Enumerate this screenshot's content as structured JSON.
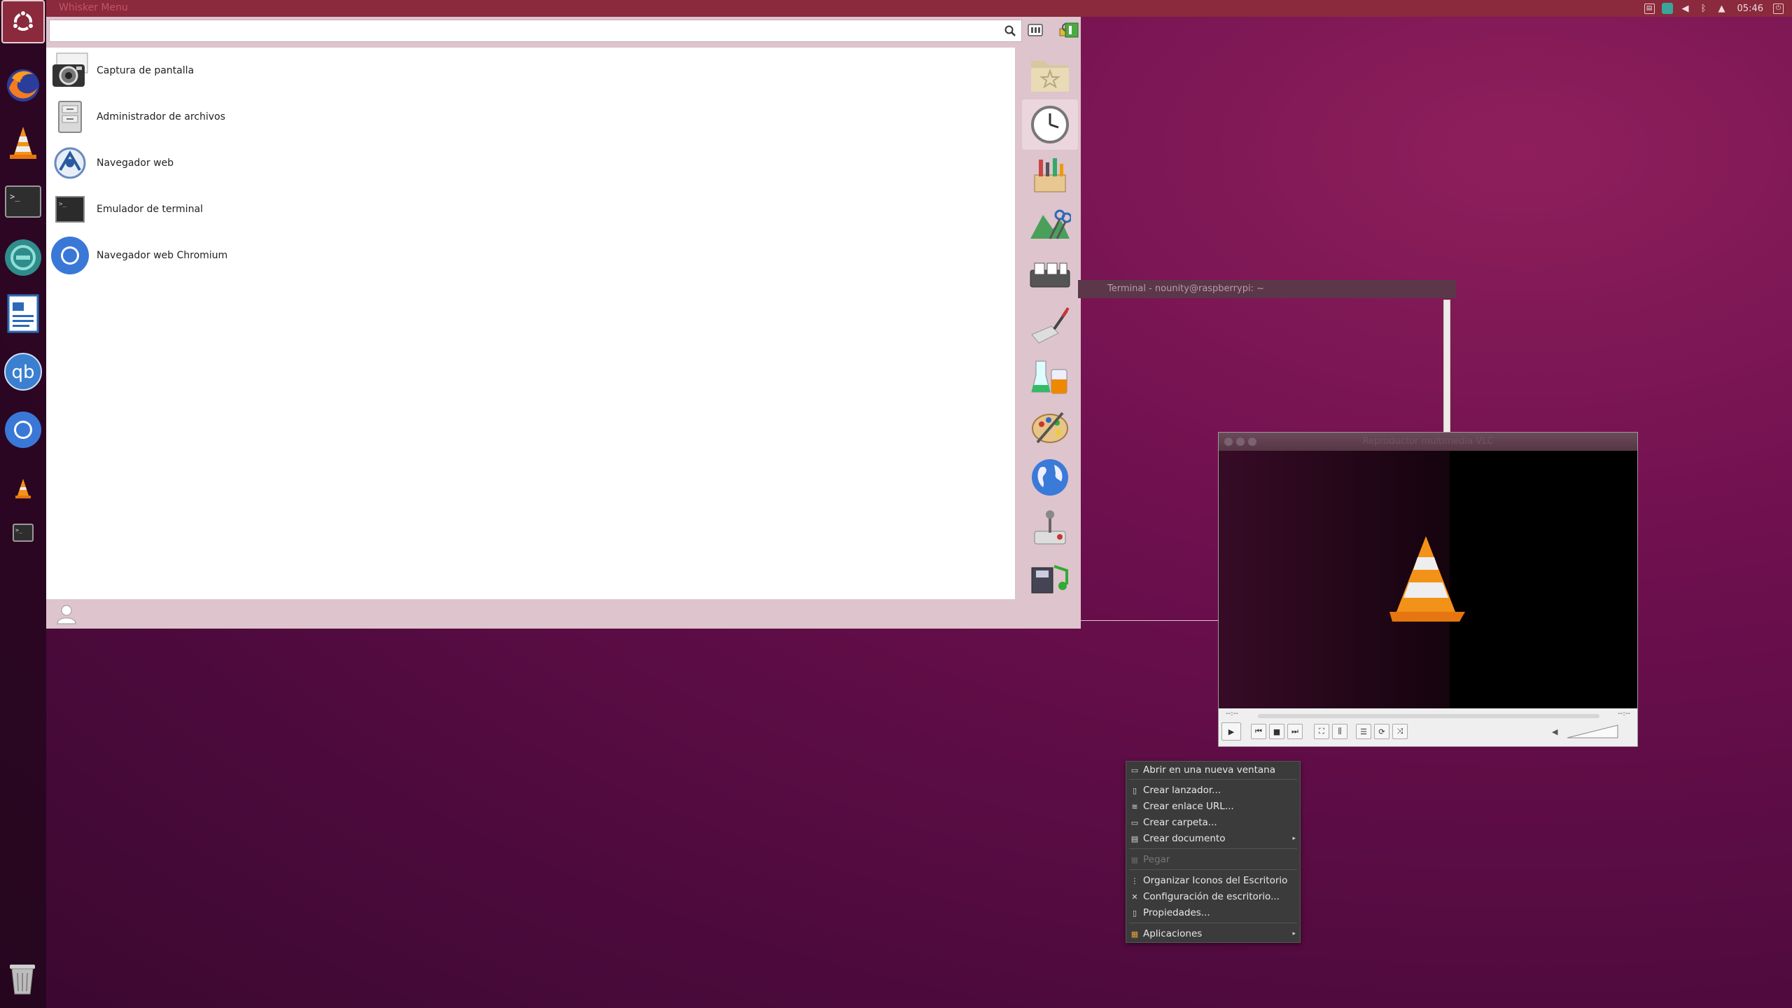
{
  "top_panel": {
    "title": "Whisker Menu",
    "clock": "05:46",
    "tray_icons": [
      "screen-icon",
      "network-icon",
      "volume-icon",
      "bluetooth-icon",
      "notification-bell-icon",
      "session-icon"
    ]
  },
  "launcher": {
    "items": [
      "Firefox",
      "VLC",
      "Terminal",
      "Network",
      "Writer",
      "qBittorrent",
      "Chromium",
      "VLC small",
      "Terminal small"
    ],
    "qb_label": "qb"
  },
  "whisker": {
    "search_placeholder": "",
    "apps": [
      {
        "label": "Captura de pantalla",
        "icon": "camera-icon"
      },
      {
        "label": "Administrador de archivos",
        "icon": "file-cabinet-icon"
      },
      {
        "label": "Navegador web",
        "icon": "web-browser-icon"
      },
      {
        "label": "Emulador de terminal",
        "icon": "terminal-icon"
      },
      {
        "label": "Navegador web Chromium",
        "icon": "chromium-icon"
      }
    ],
    "categories": [
      "favorites",
      "recently-used",
      "accessories",
      "office-tools",
      "system",
      "development",
      "science",
      "graphics",
      "internet",
      "games",
      "multimedia"
    ]
  },
  "terminal": {
    "title": "Terminal - nounity@raspberrypi: ~"
  },
  "vlc": {
    "title": "Reproductor multimedia VLC",
    "time_left": "--:--",
    "time_right": "--:--"
  },
  "context_menu": {
    "items": [
      {
        "label": "Abrir en una nueva ventana",
        "enabled": true
      },
      {
        "label": "Crear lanzador...",
        "enabled": true
      },
      {
        "label": "Crear enlace URL...",
        "enabled": true
      },
      {
        "label": "Crear carpeta...",
        "enabled": true
      },
      {
        "label": "Crear documento",
        "enabled": true,
        "submenu": true
      },
      {
        "label": "Pegar",
        "enabled": false
      },
      {
        "label": "Organizar Iconos del Escritorio",
        "enabled": true
      },
      {
        "label": "Configuración de escritorio...",
        "enabled": true
      },
      {
        "label": "Propiedades...",
        "enabled": true
      },
      {
        "label": "Aplicaciones",
        "enabled": true,
        "submenu": true
      }
    ]
  }
}
